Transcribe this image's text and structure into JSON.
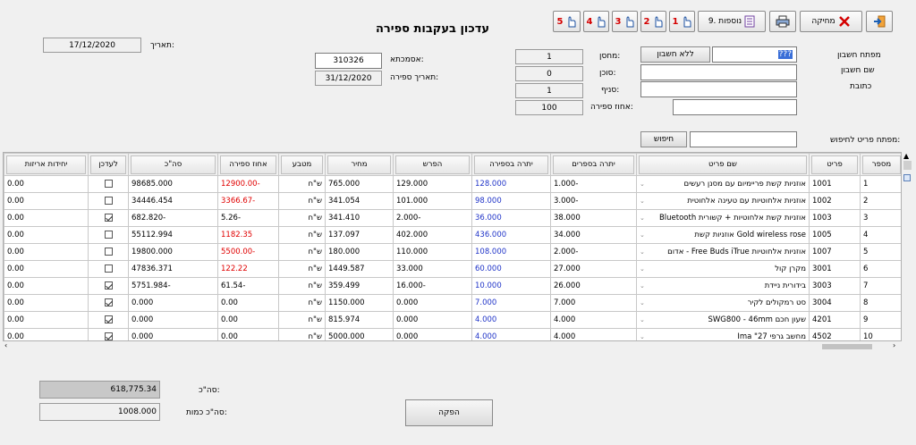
{
  "window": {
    "title": "עדכון בעקבות ספירה"
  },
  "toolbar": {
    "exit_label": "",
    "delete_label": "מחיקה",
    "print_label": "",
    "extras_label": "9. נוספות",
    "hand_buttons": [
      "1",
      "2",
      "3",
      "4",
      "5"
    ]
  },
  "header": {
    "date_label": "תאריך:",
    "date_value": "17/12/2020",
    "account_key_label": "מפתח חשבון",
    "account_key_value": "???",
    "no_account_button": "ללא חשבון",
    "account_name_label": "שם חשבון",
    "address_label": "כתובת",
    "warehouse_label": "מחסן:",
    "warehouse_value": "1",
    "agent_label": "סוכן:",
    "agent_value": "0",
    "branch_label": "סניף:",
    "branch_value": "1",
    "count_percent_label": "אחוז ספירה:",
    "count_percent_value": "100",
    "reference_label": "אסמכתא:",
    "reference_value": "310326",
    "count_date_label": "תאריך ספירה:",
    "count_date_value": "31/12/2020",
    "item_search_label": "מפתח פריט לחיפוש:",
    "search_button": "חיפוש"
  },
  "table": {
    "columns": [
      "מספר",
      "פריט",
      "שם פריט",
      "יתרה בספרים",
      "יתרה בספירה",
      "הפרש",
      "מחיר",
      "מטבע",
      "אחוז ספירה",
      "סה\"כ",
      "לעדכן",
      "יחידות אריזות"
    ],
    "rows": [
      {
        "num": "1",
        "item": "1001",
        "name": "אוזניות קשת פריימיום עם מסנן רעשים",
        "book": "-1.000",
        "count": "128.000",
        "diff": "129.000",
        "price": "765.000",
        "curr": "ש\"ח",
        "pct": "-12900.00",
        "total": "98685.000",
        "update": false,
        "units": "0.00"
      },
      {
        "num": "2",
        "item": "1002",
        "name": "אוזניות אלחוטיות עם טעינה אלחוטית",
        "book": "-3.000",
        "count": "98.000",
        "diff": "101.000",
        "price": "341.054",
        "curr": "ש\"ח",
        "pct": "-3366.67",
        "total": "34446.454",
        "update": false,
        "units": "0.00"
      },
      {
        "num": "3",
        "item": "1003",
        "name": "אוזניות קשת אלחוטיות + קשורית Bluetooth",
        "book": "38.000",
        "count": "36.000",
        "diff": "-2.000",
        "price": "341.410",
        "curr": "ש\"ח",
        "pct": "-5.26",
        "total": "-682.820",
        "update": true,
        "units": "0.00"
      },
      {
        "num": "4",
        "item": "1005",
        "name": "Gold wireless rose אוזניות קשת",
        "book": "34.000",
        "count": "436.000",
        "diff": "402.000",
        "price": "137.097",
        "curr": "ש\"ח",
        "pct": "1182.35",
        "total": "55112.994",
        "update": false,
        "units": "0.00"
      },
      {
        "num": "5",
        "item": "1007",
        "name": "אוזניות אלחוטיות Free Buds iTrue - אדום",
        "book": "-2.000",
        "count": "108.000",
        "diff": "110.000",
        "price": "180.000",
        "curr": "ש\"ח",
        "pct": "-5500.00",
        "total": "19800.000",
        "update": false,
        "units": "0.00"
      },
      {
        "num": "6",
        "item": "3001",
        "name": "מקרן קול",
        "book": "27.000",
        "count": "60.000",
        "diff": "33.000",
        "price": "1449.587",
        "curr": "ש\"ח",
        "pct": "122.22",
        "total": "47836.371",
        "update": false,
        "units": "0.00"
      },
      {
        "num": "7",
        "item": "3003",
        "name": "בידורית ניידת",
        "book": "26.000",
        "count": "10.000",
        "diff": "-16.000",
        "price": "359.499",
        "curr": "ש\"ח",
        "pct": "-61.54",
        "total": "-5751.984",
        "update": true,
        "units": "0.00"
      },
      {
        "num": "8",
        "item": "3004",
        "name": "סט רמקולים לקיר",
        "book": "7.000",
        "count": "7.000",
        "diff": "0.000",
        "price": "1150.000",
        "curr": "ש\"ח",
        "pct": "0.00",
        "total": "0.000",
        "update": true,
        "units": "0.00"
      },
      {
        "num": "9",
        "item": "4201",
        "name": "שעון חכם SWG800 - 46mm",
        "book": "4.000",
        "count": "4.000",
        "diff": "0.000",
        "price": "815.974",
        "curr": "ש\"ח",
        "pct": "0.00",
        "total": "0.000",
        "update": true,
        "units": "0.00"
      },
      {
        "num": "10",
        "item": "4502",
        "name": "מחשב גרפי 27\" Ima",
        "book": "4.000",
        "count": "4.000",
        "diff": "0.000",
        "price": "5000.000",
        "curr": "ש\"ח",
        "pct": "0.00",
        "total": "0.000",
        "update": true,
        "units": "0.00"
      }
    ]
  },
  "footer": {
    "total_label": "סה\"כ:",
    "total_value": "618,775.34",
    "qty_label": "סה\"כ כמות:",
    "qty_value": "1008.000",
    "execute_button": "הפקה"
  },
  "colors": {
    "red": "#e00000",
    "blue": "#2034c8"
  }
}
